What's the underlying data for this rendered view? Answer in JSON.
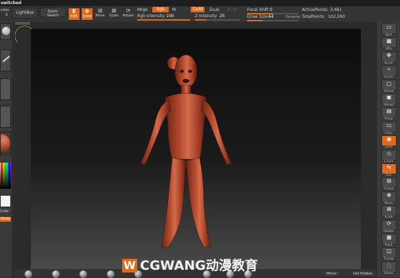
{
  "app": {
    "title": "switched"
  },
  "toolbar": {
    "action_label": "ction",
    "lightbox_label": "LightBox",
    "quick_sketch_label": "Quick\nSketch",
    "edit_label": "Edit",
    "draw_label": "Draw",
    "move_label": "Move",
    "scale_label": "Scale",
    "rotate_label": "Rotate",
    "mrgb_label": "Mrgb",
    "rgb_label": "Rgb",
    "m_label": "M",
    "zadd_label": "Zadd",
    "zsub_label": "Zsub",
    "zcut_label": "Zcut",
    "rgb_intensity_label": "Rgb Intensity",
    "rgb_intensity_value": "100",
    "z_intensity_label": "Z Intensity",
    "z_intensity_value": "25",
    "focal_shift_label": "Focal Shift",
    "focal_shift_value": "0",
    "draw_size_label": "Draw Size",
    "draw_size_value": "64",
    "dynamic_label": "Dynamic",
    "active_points_label": "ActivePoints:",
    "active_points_value": "3,481",
    "total_points_label": "TotalPoints:",
    "total_points_value": "102,590",
    "sliders": {
      "rgb_intensity": 1.0,
      "z_intensity": 0.25,
      "focal_shift": 0.5,
      "draw_size": 0.3
    }
  },
  "left_shelf": {
    "color_label": "Color",
    "white_label": "White"
  },
  "right_shelf": {
    "items": [
      {
        "label": "Brill"
      },
      {
        "label": "SPix"
      },
      {
        "label": "Scroll"
      },
      {
        "label": "Zoom"
      },
      {
        "label": "Actual"
      },
      {
        "label": "AAHalf"
      },
      {
        "label": "Persp"
      },
      {
        "label": "Floor"
      },
      {
        "label": "Local"
      },
      {
        "label": "L.Sym"
      },
      {
        "label": "Xyz"
      },
      {
        "label": "Frame"
      },
      {
        "label": "Move"
      },
      {
        "label": "Scale"
      },
      {
        "label": "Rotate"
      },
      {
        "label": "PolyF"
      },
      {
        "label": "Transp"
      },
      {
        "label": "Ghost"
      }
    ]
  },
  "bottom_bar": {
    "mirror_label": "Mirror",
    "del_hidden_label": "Del Hidden"
  },
  "watermark": {
    "text": "CGWANG动漫教育",
    "logo_letter": "W"
  },
  "colors": {
    "accent": "#e06a1b",
    "model": "#b54a2e",
    "background": "#2b2b2b"
  }
}
